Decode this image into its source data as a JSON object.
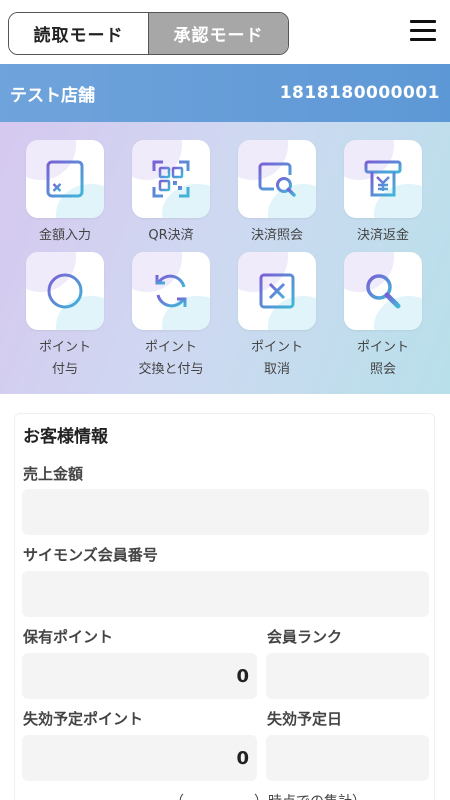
{
  "header": {
    "mode_read": "読取モード",
    "mode_approve": "承認モード",
    "menu_icon": "hamburger-menu-icon"
  },
  "store": {
    "name": "テスト店舗",
    "id": "1818180000001"
  },
  "actions": [
    {
      "label_line1": "金額入力",
      "label_line2": "",
      "icon": "calculator-icon"
    },
    {
      "label_line1": "QR決済",
      "label_line2": "",
      "icon": "qr-code-icon"
    },
    {
      "label_line1": "決済照会",
      "label_line2": "",
      "icon": "payment-search-icon"
    },
    {
      "label_line1": "決済返金",
      "label_line2": "",
      "icon": "refund-icon"
    },
    {
      "label_line1": "ポイント",
      "label_line2": "付与",
      "icon": "plus-circle-icon"
    },
    {
      "label_line1": "ポイント",
      "label_line2": "交換と付与",
      "icon": "exchange-icon"
    },
    {
      "label_line1": "ポイント",
      "label_line2": "取消",
      "icon": "cancel-x-icon"
    },
    {
      "label_line1": "ポイント",
      "label_line2": "照会",
      "icon": "magnifier-icon"
    }
  ],
  "customer": {
    "title": "お客様情報",
    "sales_amount_label": "売上金額",
    "sales_amount_value": "",
    "member_number_label": "サイモンズ会員番号",
    "member_number_value": "",
    "held_points_label": "保有ポイント",
    "held_points_value": "0",
    "member_rank_label": "会員ランク",
    "member_rank_value": "",
    "expiring_points_label": "失効予定ポイント",
    "expiring_points_value": "0",
    "expiry_date_label": "失効予定日",
    "expiry_date_value": "",
    "footnote": "（　　　　　）時点での集計）"
  },
  "colors": {
    "store_bar": "#5d98d6",
    "icon_gradient_start": "#7a5fd6",
    "icon_gradient_end": "#3fb6d8",
    "inactive_mode": "#a7a7a7"
  }
}
